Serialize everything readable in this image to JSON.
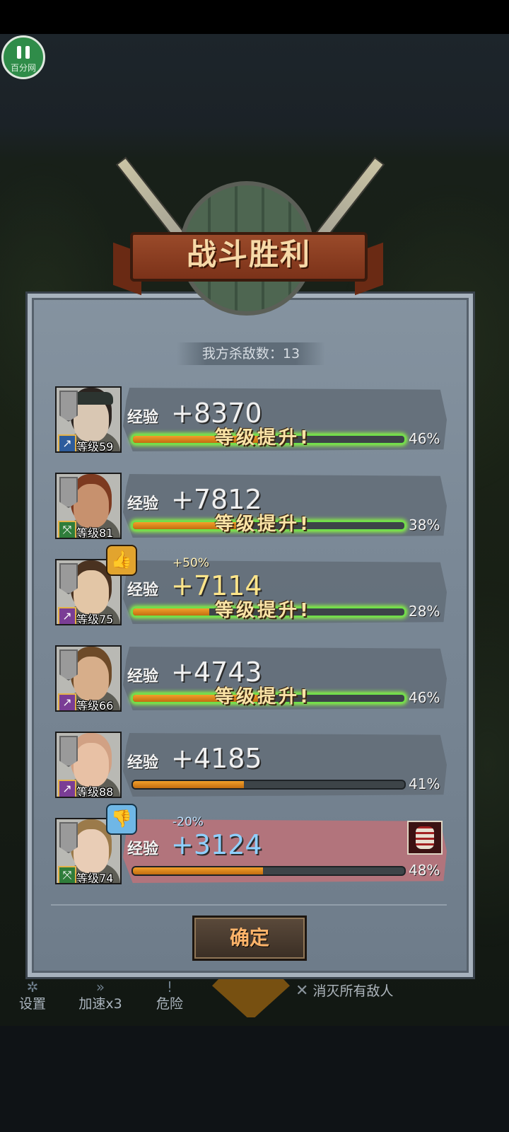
{
  "pause": {
    "watermark": "百分网"
  },
  "title": "战斗胜利",
  "kills": {
    "label": "我方杀敌数：13"
  },
  "rows": [
    {
      "level": "等级59",
      "xp_label": "经验",
      "xp": "+8370",
      "bonus": "",
      "progress_pct": 46,
      "pct_label": "46%",
      "level_up": "等级提升!",
      "class": "blue",
      "class_icon": "sword-icon"
    },
    {
      "level": "等级81",
      "xp_label": "经验",
      "xp": "+7812",
      "bonus": "",
      "progress_pct": 38,
      "pct_label": "38%",
      "level_up": "等级提升!",
      "class": "green",
      "class_icon": "bow-icon"
    },
    {
      "level": "等级75",
      "xp_label": "经验",
      "xp": "+7114",
      "bonus": "+50%",
      "progress_pct": 28,
      "pct_label": "28%",
      "level_up": "等级提升!",
      "class": "purple",
      "class_icon": "staff-icon",
      "badge": "thumbs-up-icon"
    },
    {
      "level": "等级66",
      "xp_label": "经验",
      "xp": "+4743",
      "bonus": "",
      "progress_pct": 46,
      "pct_label": "46%",
      "level_up": "等级提升!",
      "class": "purple",
      "class_icon": "staff-icon"
    },
    {
      "level": "等级88",
      "xp_label": "经验",
      "xp": "+4185",
      "bonus": "",
      "progress_pct": 41,
      "pct_label": "41%",
      "level_up": "",
      "class": "purple",
      "class_icon": "staff-icon"
    },
    {
      "level": "等级74",
      "xp_label": "经验",
      "xp": "+3124",
      "bonus": "-20%",
      "progress_pct": 48,
      "pct_label": "48%",
      "level_up": "",
      "class": "green",
      "class_icon": "bow-icon",
      "badge": "thumbs-down-icon",
      "injured": true
    }
  ],
  "confirm": "确定",
  "bottom": {
    "settings": "设置",
    "speed": "加速x3",
    "danger": "危险",
    "objective": "消灭所有敌人"
  },
  "colors": {
    "panel": "#7a8896",
    "banner": "#8f3f22",
    "confirm_text": "#ffb46a",
    "xp_bar": "#e08a1d",
    "levelup_glow": "#8cff40"
  }
}
